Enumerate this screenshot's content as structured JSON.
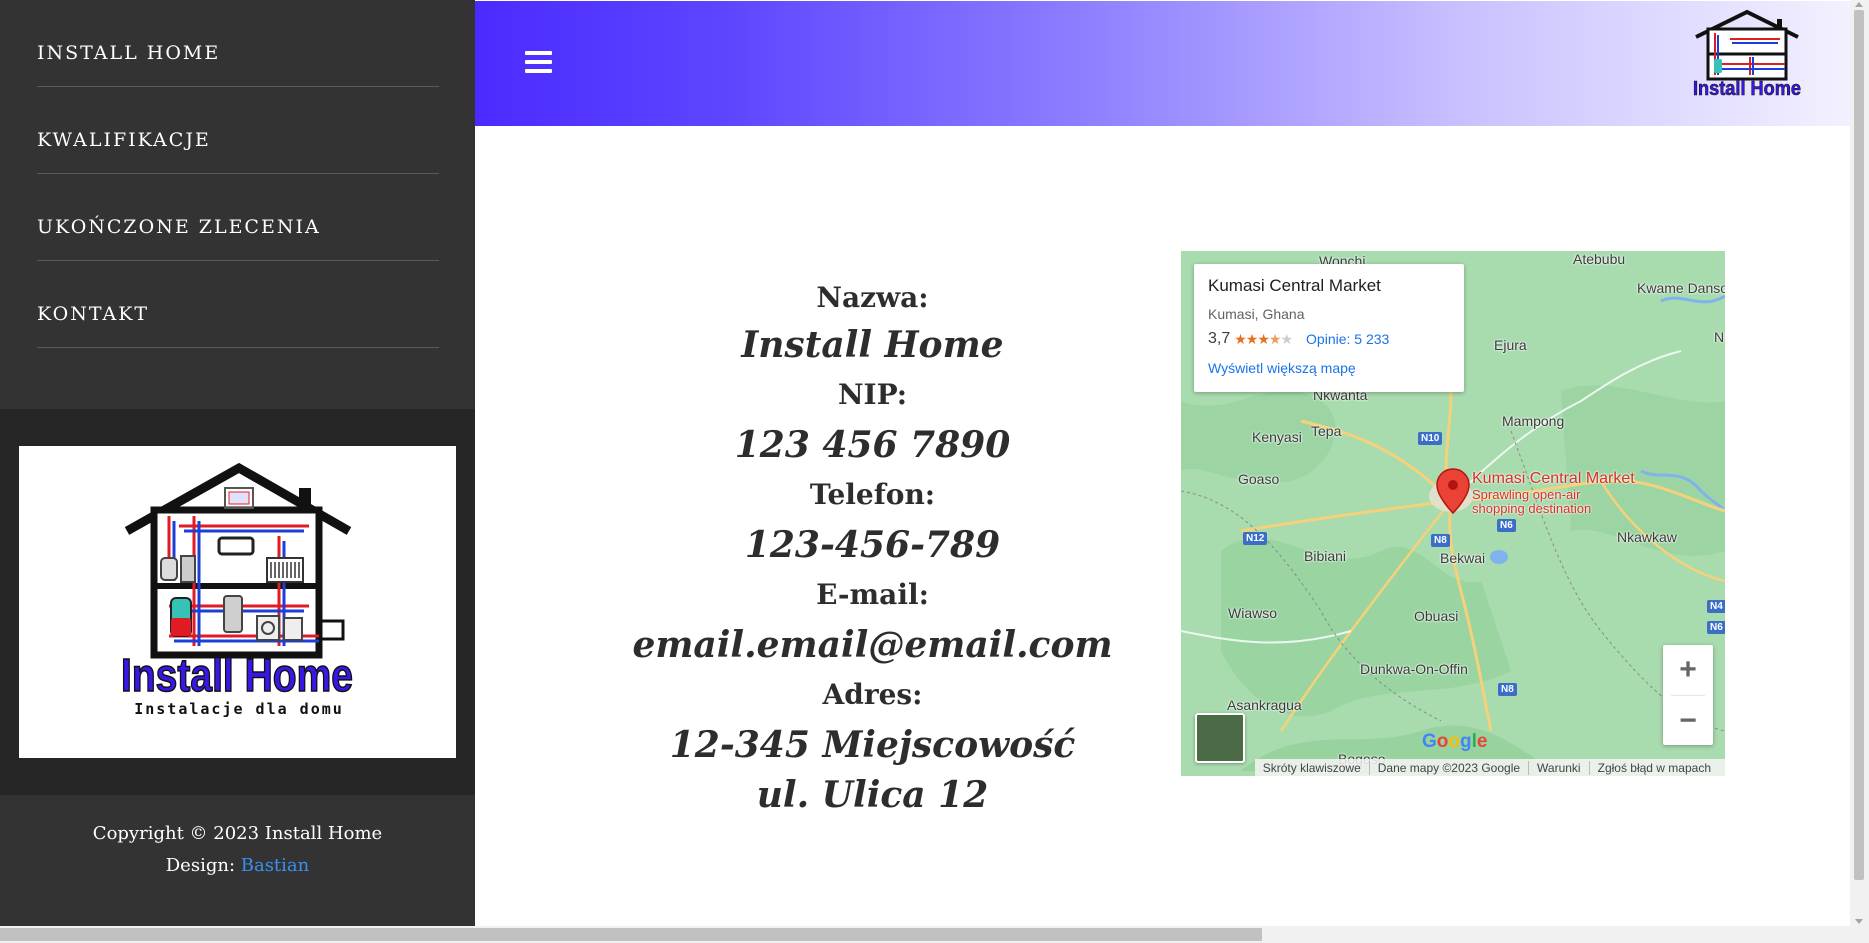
{
  "sidebar": {
    "nav": [
      {
        "label": "INSTALL HOME"
      },
      {
        "label": "KWALIFIKACJE"
      },
      {
        "label": "UKOŃCZONE ZLECENIA"
      },
      {
        "label": "KONTAKT"
      }
    ],
    "logo": {
      "brand": "Install Home",
      "tagline": "Instalacje dla domu"
    },
    "footer": {
      "copyright": "Copyright © 2023 Install Home",
      "design_prefix": "Design: ",
      "design_link": "Bastian"
    }
  },
  "header": {
    "logo_text": "Install Home"
  },
  "contact": {
    "name_label": "Nazwa:",
    "name_value": "Install Home",
    "nip_label": "NIP:",
    "nip_value": "123 456 7890",
    "phone_label": "Telefon:",
    "phone_value": "123-456-789",
    "email_label": "E-mail:",
    "email_value": "email.email@email.com",
    "address_label": "Adres:",
    "address_line1": "12-345 Miejscowość",
    "address_line2": "ul. Ulica 12"
  },
  "map": {
    "place_name": "Kumasi Central Market",
    "place_address": "Kumasi, Ghana",
    "rating": "3,7",
    "rating_value": 3.7,
    "reviews": "Opinie: 5 233",
    "larger_map": "Wyświetl większą mapę",
    "pin_title": "Kumasi Central Market",
    "pin_subtitle_1": "Sprawling open-air",
    "pin_subtitle_2": "shopping destination",
    "zoom_in": "+",
    "zoom_out": "−",
    "attribution": [
      "Skróty klawiszowe",
      "Dane mapy ©2023 Google",
      "Warunki",
      "Zgłoś błąd w mapach"
    ],
    "places": {
      "wonchi": "Wonchi",
      "atebubu": "Atebubu",
      "kwame_danso": "Kwame Danso",
      "ejura": "Ejura",
      "nkwanta": "Nkwanta",
      "kenyasi": "Kenyasi",
      "tepa": "Tepa",
      "mampong": "Mampong",
      "goaso": "Goaso",
      "bibiani": "Bibiani",
      "bekwai": "Bekwai",
      "nkawkaw": "Nkawkaw",
      "wiawso": "Wiawso",
      "obuasi": "Obuasi",
      "dunkwa": "Dunkwa-On-Offin",
      "asankragua": "Asankragua",
      "bogoso": "Bogoso",
      "n_edge": "N"
    },
    "roads": {
      "n10": "N10",
      "n12": "N12",
      "n8a": "N8",
      "n8b": "N8",
      "n6a": "N6",
      "n6b": "N6",
      "n4": "N4"
    }
  },
  "colors": {
    "sidebar": "#333333",
    "sidebar_dark": "#262626",
    "header_start": "#4a2bff",
    "header_end": "#f3f1ff",
    "link": "#3a8ff2",
    "map_pin": "#d93025",
    "map_link": "#1a73e8"
  }
}
